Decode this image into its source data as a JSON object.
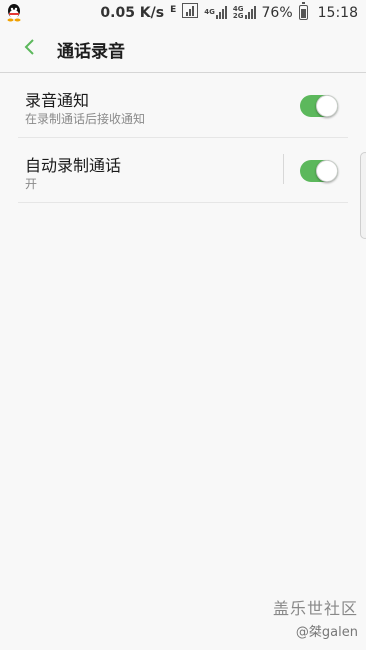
{
  "status_bar": {
    "net_speed": "0.05 K/s",
    "battery_percent": "76%",
    "time": "15:18",
    "net_label_left": "4G",
    "net_label_right_top": "4G",
    "net_label_right_bottom": "2G",
    "icons": [
      "qq-icon",
      "nfc-icon",
      "signal-icon",
      "battery-icon"
    ]
  },
  "app_bar": {
    "title": "通话录音"
  },
  "settings": [
    {
      "title": "录音通知",
      "subtitle": "在录制通话后接收通知",
      "toggle_on": true
    },
    {
      "title": "自动录制通话",
      "subtitle": "开",
      "toggle_on": true
    }
  ],
  "watermark": {
    "line1": "盖乐世社区",
    "line2": "@桀galen"
  },
  "colors": {
    "accent": "#5cb85c",
    "background": "#f8f8f8"
  }
}
